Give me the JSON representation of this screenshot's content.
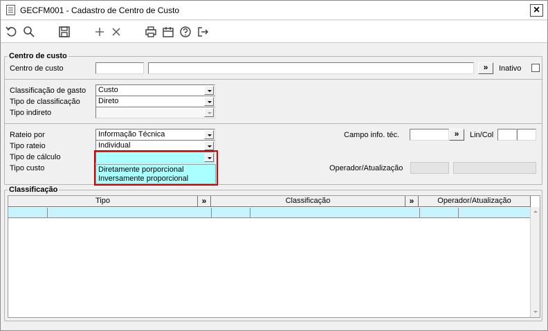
{
  "window": {
    "title": "GECFM001 - Cadastro de Centro de Custo",
    "close_label": "×"
  },
  "toolbar": {
    "icons": [
      "undo-icon",
      "search-icon",
      "save-icon",
      "add-icon",
      "delete-icon",
      "print-icon",
      "calendar-icon",
      "help-icon",
      "exit-icon"
    ]
  },
  "section_centro": {
    "legend": "Centro de custo",
    "centro_label": "Centro de custo",
    "centro_code": "",
    "centro_desc": "",
    "lookup_label": "»",
    "inativo_label": "Inativo",
    "classificacao_gasto_label": "Classificação de gasto",
    "classificacao_gasto_value": "Custo",
    "tipo_classificacao_label": "Tipo de classificação",
    "tipo_classificacao_value": "Direto",
    "tipo_indireto_label": "Tipo indireto",
    "tipo_indireto_value": "",
    "rateio_por_label": "Rateio por",
    "rateio_por_value": "Informação Técnica",
    "tipo_rateio_label": "Tipo rateio",
    "tipo_rateio_value": "Individual",
    "tipo_calculo_label": "Tipo de cálculo",
    "tipo_calculo_value": "",
    "tipo_calculo_options": [
      "Diretamente porporcional",
      "Inversamente proporcional"
    ],
    "tipo_custo_label": "Tipo custo",
    "campo_info_label": "Campo info. téc.",
    "campo_info_value": "",
    "lin_col_label": "Lin/Col",
    "operador_label": "Operador/Atualização"
  },
  "section_classificacao": {
    "legend": "Classificação",
    "columns": [
      "Tipo",
      "»",
      "Classificação",
      "»",
      "Operador/Atualização"
    ]
  },
  "colors": {
    "accent_highlight": "#d40000",
    "dropdown_bg": "#aaffff",
    "grid_row": "#c7f3ff"
  }
}
